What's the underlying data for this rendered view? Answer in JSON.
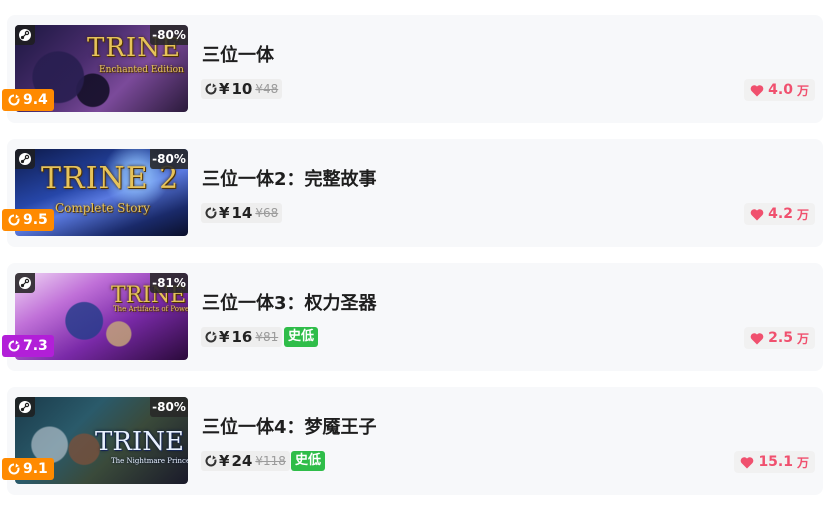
{
  "colors": {
    "score_orange": "#ff8a00",
    "score_purple": "#b21fd8",
    "sale_green": "#2fbd49",
    "heart_red": "#f0506e"
  },
  "items": [
    {
      "title": "三位一体",
      "cover_logo": "TRINE",
      "cover_sub": "Enchanted Edition",
      "discount": "-80%",
      "score": "9.4",
      "score_color": "#ff8a00",
      "currency": "¥",
      "price": "10",
      "original_price": "¥48",
      "historic_low": "",
      "likes": "4.0",
      "likes_unit": "万",
      "platform_icon": "steam-icon"
    },
    {
      "title": "三位一体2：完整故事",
      "cover_logo": "TRINE 2",
      "cover_sub": "Complete Story",
      "discount": "-80%",
      "score": "9.5",
      "score_color": "#ff8a00",
      "currency": "¥",
      "price": "14",
      "original_price": "¥68",
      "historic_low": "",
      "likes": "4.2",
      "likes_unit": "万",
      "platform_icon": "steam-icon"
    },
    {
      "title": "三位一体3：权力圣器",
      "cover_logo": "TRINE 3",
      "cover_sub": "The Artifacts of Power",
      "discount": "-81%",
      "score": "7.3",
      "score_color": "#b21fd8",
      "currency": "¥",
      "price": "16",
      "original_price": "¥81",
      "historic_low": "史低",
      "likes": "2.5",
      "likes_unit": "万",
      "platform_icon": "steam-icon"
    },
    {
      "title": "三位一体4：梦魇王子",
      "cover_logo": "TRINE 4",
      "cover_sub": "The Nightmare Prince",
      "discount": "-80%",
      "score": "9.1",
      "score_color": "#ff8a00",
      "currency": "¥",
      "price": "24",
      "original_price": "¥118",
      "historic_low": "史低",
      "likes": "15.1",
      "likes_unit": "万",
      "platform_icon": "steam-icon"
    }
  ]
}
